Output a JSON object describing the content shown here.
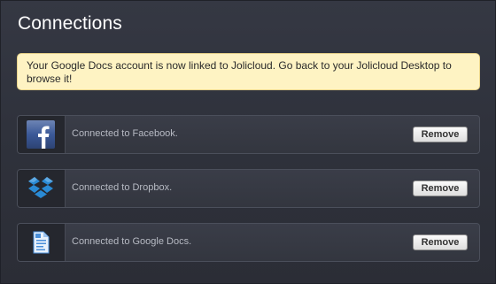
{
  "page": {
    "title": "Connections"
  },
  "notice": {
    "text": "Your Google Docs account is now linked to Jolicloud. Go back to your Jolicloud Desktop to browse it!"
  },
  "connections": [
    {
      "service": "Facebook",
      "icon": "facebook-icon",
      "status": "Connected to Facebook.",
      "button_label": "Remove"
    },
    {
      "service": "Dropbox",
      "icon": "dropbox-icon",
      "status": "Connected to Dropbox.",
      "button_label": "Remove"
    },
    {
      "service": "Google Docs",
      "icon": "google-docs-icon",
      "status": "Connected to Google Docs.",
      "button_label": "Remove"
    }
  ],
  "colors": {
    "notice_bg": "#fef3c3",
    "panel_bg": "#353843",
    "facebook_blue": "#3b5998",
    "dropbox_blue": "#2a8ad4",
    "google_docs_blue": "#4a8fd9"
  }
}
